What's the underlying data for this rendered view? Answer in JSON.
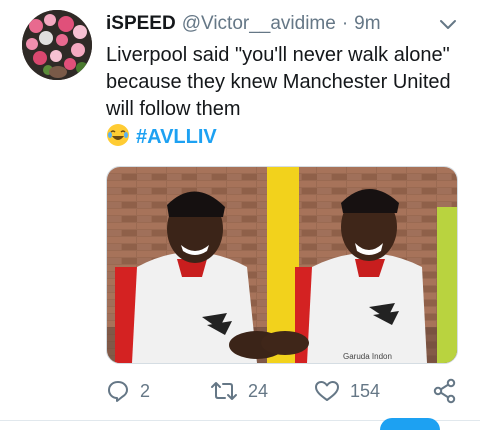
{
  "tweet": {
    "author_name": "iSPEED",
    "author_handle": "@Victor__avidime",
    "separator": "·",
    "timestamp": "9m",
    "text": "Liverpool said \"you'll never walk alone\" because they knew Manchester United will follow them",
    "hashtag": "#AVLLIV",
    "media": {
      "watermark": "Garuda Indon"
    }
  },
  "actions": {
    "reply_count": "2",
    "retweet_count": "24",
    "like_count": "154"
  },
  "colors": {
    "accent": "#1da1f2",
    "secondary_text": "#657786",
    "primary_text": "#14171a"
  }
}
